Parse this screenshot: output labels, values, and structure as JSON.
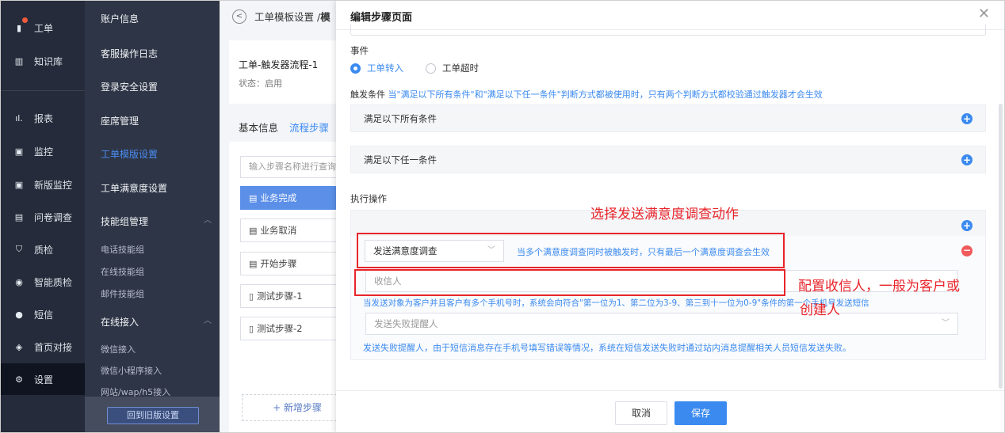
{
  "nav": {
    "items": [
      {
        "label": "工单",
        "icon": "ticket-icon",
        "glyph": "▮"
      },
      {
        "label": "知识库",
        "icon": "book-icon",
        "glyph": "▥"
      },
      {
        "label": "报表",
        "icon": "bar-chart-icon",
        "glyph": "ıl."
      },
      {
        "label": "监控",
        "icon": "monitor-icon",
        "glyph": "▣"
      },
      {
        "label": "新版监控",
        "icon": "new-monitor-icon",
        "glyph": "▣"
      },
      {
        "label": "问卷调查",
        "icon": "survey-icon",
        "glyph": "▤"
      },
      {
        "label": "质检",
        "icon": "shield-icon",
        "glyph": "⛉"
      },
      {
        "label": "智能质检",
        "icon": "smart-check-icon",
        "glyph": "◉"
      },
      {
        "label": "短信",
        "icon": "sms-icon",
        "glyph": "●"
      },
      {
        "label": "首页对接",
        "icon": "link-icon",
        "glyph": "◈"
      },
      {
        "label": "设置",
        "icon": "gear-icon",
        "glyph": "⚙"
      }
    ]
  },
  "submenu": {
    "items": [
      {
        "label": "账户信息"
      },
      {
        "label": "客服操作日志"
      },
      {
        "label": "登录安全设置"
      },
      {
        "label": "座席管理"
      },
      {
        "label": "工单模版设置"
      },
      {
        "label": "工单满意度设置"
      },
      {
        "label": "技能组管理"
      },
      {
        "label": "电话技能组"
      },
      {
        "label": "在线技能组"
      },
      {
        "label": "邮件技能组"
      },
      {
        "label": "在线接入"
      },
      {
        "label": "微信接入"
      },
      {
        "label": "微信小程序接入"
      },
      {
        "label": "网站/wap/h5接入"
      }
    ],
    "old_settings_button": "回到旧版设置"
  },
  "main": {
    "breadcrumb": "工单模板设置 / ",
    "breadcrumb_current": "模",
    "flow_title": "工单-触发器流程-1",
    "flow_status": "状态：启用",
    "tabs": [
      "基本信息",
      "流程步骤"
    ],
    "search_placeholder": "输入步骤名称进行查询",
    "steps": [
      {
        "label": "业务完成",
        "icon": "doc-icon"
      },
      {
        "label": "业务取消",
        "icon": "doc-icon"
      },
      {
        "label": "开始步骤",
        "icon": "doc-icon"
      },
      {
        "label": "测试步骤-1",
        "icon": "file-icon"
      },
      {
        "label": "测试步骤-2",
        "icon": "file-icon"
      }
    ],
    "add_step": "+ 新增步骤"
  },
  "drawer": {
    "title": "编辑步骤页面",
    "event_label": "事件",
    "event_options": [
      "工单转入",
      "工单超时"
    ],
    "event_selected": 0,
    "trigger_label": "触发条件",
    "trigger_hint": "当\"满足以下所有条件\"和\"满足以下任一条件\"判断方式都被使用时，只有两个判断方式都校验通过触发器才会生效",
    "cond_all": "满足以下所有条件",
    "cond_any": "满足以下任一条件",
    "exec_label": "执行操作",
    "action_select": "发送满意度调查",
    "action_note": "当多个满意度调查同时被触发时，只有最后一个满意度调查会生效",
    "receiver_placeholder": "收信人",
    "receiver_note": "当发送对象为客户并且客户有多个手机号时，系统会向符合\"第一位为1、第二位为3-9、第三到十一位为0-9\"条件的第一个手机号发送短信",
    "fail_placeholder": "发送失败提醒人",
    "fail_note": "发送失败提醒人，由于短信消息存在手机号填写错误等情况，系统在短信发送失败时通过站内消息提醒相关人员短信发送失败。",
    "cancel": "取消",
    "save": "保存"
  },
  "annotations": {
    "note1": "选择发送满意度调查动作",
    "note2_line1": "配置收信人，一般为客户或",
    "note2_line2": "创建人"
  },
  "colors": {
    "accent": "#3b8af0",
    "annotation": "#e8252b",
    "nav_bg": "#252b3a"
  }
}
